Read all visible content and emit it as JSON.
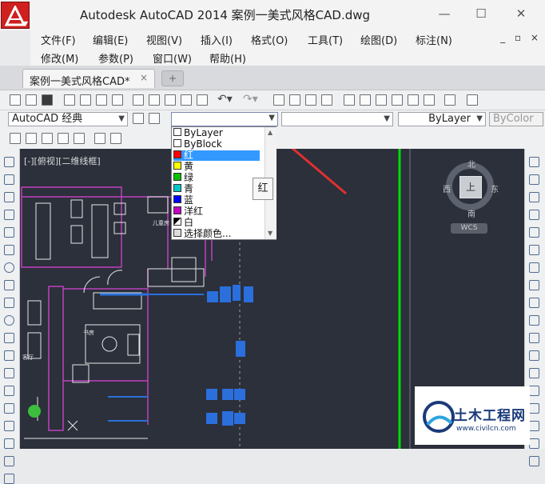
{
  "app": {
    "window_title": "Autodesk AutoCAD 2014    案例一美式风格CAD.dwg",
    "controls": {
      "minimize": "—",
      "maximize": "☐",
      "close": "✕",
      "mdi": "_ ▫ ×"
    }
  },
  "menu": {
    "row1": [
      "文件(F)",
      "编辑(E)",
      "视图(V)",
      "插入(I)",
      "格式(O)",
      "工具(T)",
      "绘图(D)",
      "标注(N)"
    ],
    "row2": [
      "修改(M)",
      "参数(P)",
      "窗口(W)",
      "帮助(H)"
    ]
  },
  "tabs": {
    "active": "案例一美式风格CAD*",
    "close": "×"
  },
  "toolbar": {
    "workspace": "AutoCAD 经典",
    "linetype": "ByLayer",
    "lineweight": "ByColor"
  },
  "viewport": {
    "label": "[-][俯视][二维线框]"
  },
  "color_dropdown": {
    "selected_value": "",
    "options": [
      {
        "label": "ByLayer",
        "swatch": "#ffffff"
      },
      {
        "label": "ByBlock",
        "swatch": "#ffffff"
      },
      {
        "label": "红",
        "swatch": "#ff0000"
      },
      {
        "label": "黄",
        "swatch": "#ffff00"
      },
      {
        "label": "绿",
        "swatch": "#00c000"
      },
      {
        "label": "青",
        "swatch": "#00c8c8"
      },
      {
        "label": "蓝",
        "swatch": "#0000ff"
      },
      {
        "label": "洋红",
        "swatch": "#c000c0"
      },
      {
        "label": "白",
        "swatch": "#ffffff"
      },
      {
        "label": "选择颜色...",
        "swatch": "#dddddd"
      }
    ],
    "highlighted": "红",
    "preview_label": "红"
  },
  "viewcube": {
    "north": "北",
    "south": "南",
    "west": "西",
    "east": "东",
    "face": "上",
    "wcs": "WCS"
  },
  "drawing_labels": {
    "room1": "儿童房",
    "room2": "书房",
    "room3": "客厅"
  },
  "watermark": {
    "title": "土木工程网",
    "url": "www.civilcn.com"
  },
  "colors": {
    "canvas": "#2b303b",
    "accent_red": "#e03030",
    "highlight": "#3399ff",
    "green_axis": "#00dd00",
    "wall_magenta": "#c040c0",
    "furniture_blue": "#2a6fdb"
  }
}
